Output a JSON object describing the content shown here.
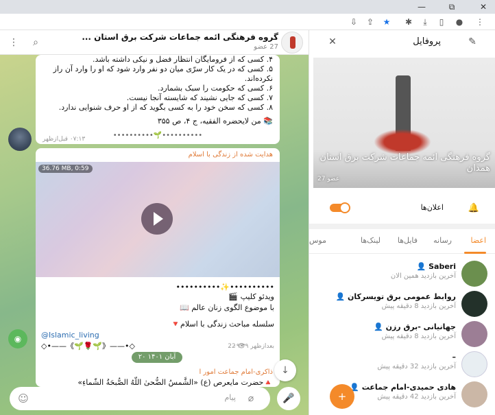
{
  "browser": {
    "minimize": "—",
    "restore": "⧉",
    "close": "✕"
  },
  "chat": {
    "title": "گروه فرهنگی ائمه جماعات شرکت برق استان ...",
    "members_count": "27 عضو",
    "message1": {
      "lines": [
        "۴. کسی که از فرومایگان انتظار فضل و نیکی داشته باشد.",
        "۵. کسی که در یک کار سرّی میان دو نفر وارد شود که او را وارد آن راز نکرده‌اند.",
        "۶. کسی که حکومت را سبک بشمارد.",
        "۷. کسی که جایی نشیند که شایسته آنجا نیست.",
        "۸. کسی که سخن خود را به کسی بگوید که از او حرف شنوایی ندارد."
      ],
      "source": "📚 من لایحضره الفقیه، ج ۴، ص ۳۵۵",
      "divider": "••••••••••🌱••••••••••",
      "time": "۰۷:۱۳ قبل‌ازظهر"
    },
    "message2": {
      "forwarded": "هدایت شده از زندگی با اسلام",
      "video_badge": "36.76 MB, 0:59",
      "divider": "••••••••••✨••••••••••",
      "line1": "ویدئو کلیپ 🎬",
      "line2": "با موضوع الگوی زنان عالم 📖",
      "line3": "سلسله مباحث زندگی با اسلام🔻",
      "tag": "@Islamic_living",
      "ornament": "◇•——《🌱🌹🌱》——•◇",
      "views": "22 👁",
      "time": "۰۹:۳۹ بعدازظهر"
    },
    "date_separator": "۲۰ آبان ۱۴۰۱",
    "message3": {
      "sender": "ذاکری-امام جماعت امور ا",
      "preview": "🔺حضرت مایعرص (ع) «الشَّمسُ الضُّحیٰ اللّهُ الصُّبحَةُ الشّماءِ»"
    },
    "composer_placeholder": "پیام"
  },
  "profile": {
    "header_title": "پروفایل",
    "cover_title": "گروه فرهنگی ائمه جماعات شرکت برق استان همدان",
    "cover_subtitle": "27 عضو",
    "notifications_label": "اعلان‌ها",
    "tabs": [
      "اعضا",
      "رسانه",
      "فایل‌ها",
      "لینک‌ها",
      "موس"
    ],
    "members": [
      {
        "name": "Saberi 👤",
        "status": "آخرین بازدید همین الان",
        "avatar_color": "#6b8f4e"
      },
      {
        "name": "روابط عمومی برق تویسرکان 👤",
        "status": "آخرین بازدید 8 دقیقه پیش",
        "avatar_color": "#23312a"
      },
      {
        "name": "جهانیانی -برق رزن 👤",
        "status": "آخرین بازدید 8 دقیقه پیش",
        "avatar_color": "#9c7e95"
      },
      {
        "name": "–",
        "status": "آخرین بازدید 32 دقیقه پیش",
        "avatar_color": "#e8eef2"
      },
      {
        "name": "هادی حمیدی-امام جماعت 👤",
        "status": "آخرین بازدید 42 دقیقه پیش",
        "avatar_color": "#cbb7a6"
      }
    ]
  }
}
